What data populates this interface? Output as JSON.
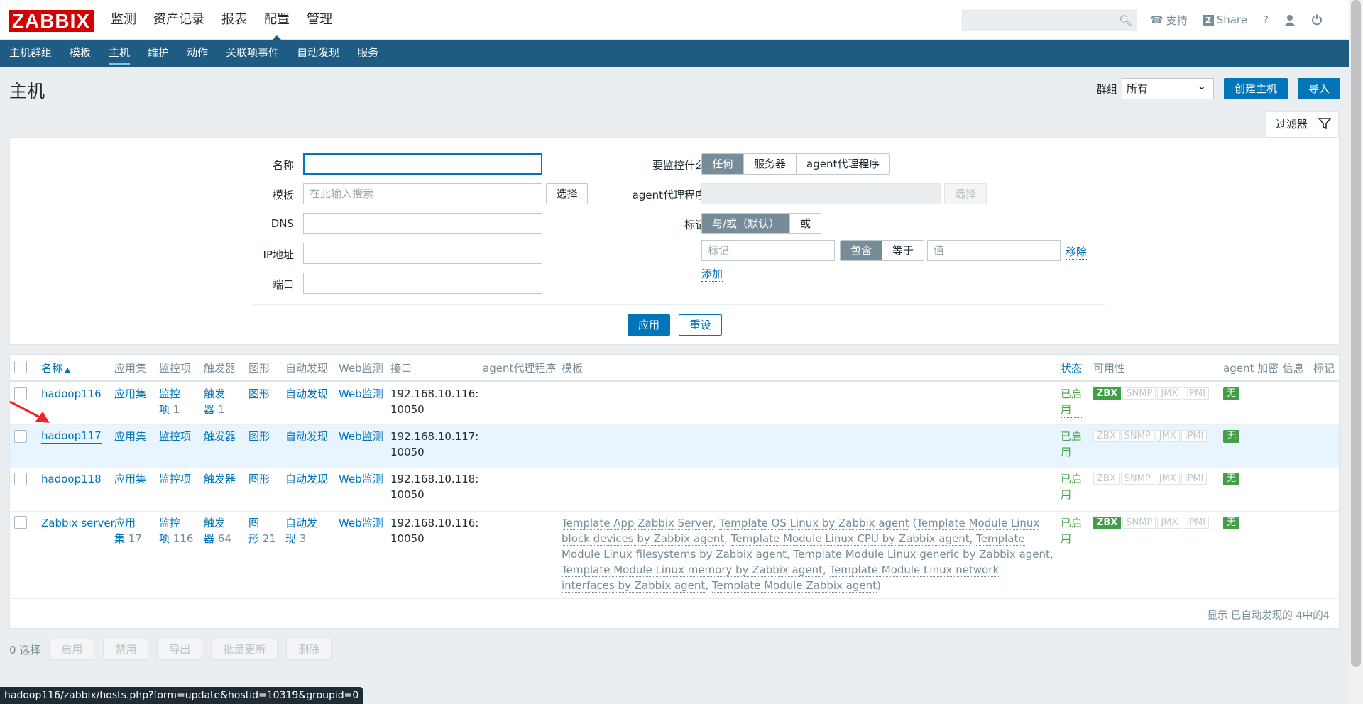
{
  "logo": "ZABBIX",
  "topmenu": [
    "监测",
    "资产记录",
    "报表",
    "配置",
    "管理"
  ],
  "toplinks": {
    "support": "支持",
    "share": "Share",
    "help": "?"
  },
  "submenu": [
    "主机群组",
    "模板",
    "主机",
    "维护",
    "动作",
    "关联项事件",
    "自动发现",
    "服务"
  ],
  "page": {
    "title": "主机",
    "group_label": "群组",
    "group_value": "所有",
    "create_btn": "创建主机",
    "import_btn": "导入"
  },
  "filter": {
    "tab": "过滤器",
    "name_label": "名称",
    "template_label": "模板",
    "template_placeholder": "在此输入搜索",
    "select_btn": "选择",
    "dns_label": "DNS",
    "ip_label": "IP地址",
    "port_label": "端口",
    "monitored_by_label": "要监控什么",
    "monitored_by": [
      "任何",
      "服务器",
      "agent代理程序"
    ],
    "proxy_label": "agent代理程序",
    "proxy_select_btn": "选择",
    "tags_label": "标记",
    "tags_mode": [
      "与/或（默认）",
      "或"
    ],
    "tag_placeholder": "标记",
    "tag_ops": [
      "包含",
      "等于"
    ],
    "value_placeholder": "值",
    "remove": "移除",
    "add": "添加",
    "apply": "应用",
    "reset": "重设"
  },
  "table": {
    "headers": {
      "name": "名称",
      "apps": "应用集",
      "items": "监控项",
      "triggers": "触发器",
      "graphs": "图形",
      "discovery": "自动发现",
      "web": "Web监测",
      "interface": "接口",
      "proxy": "agent代理程序",
      "templates": "模板",
      "status": "状态",
      "availability": "可用性",
      "encryption": "agent 加密",
      "info": "信息",
      "tags": "标记"
    },
    "rows": [
      {
        "name": "hadoop116",
        "apps": "应用集",
        "apps_count": "",
        "items_a": "监控",
        "items_b": "项",
        "items_count": "1",
        "triggers_a": "触发",
        "triggers_b": "器",
        "triggers_count": "1",
        "graphs": "图形",
        "discovery": "自动发现",
        "web": "Web监测",
        "interface_a": "192.168.10.116:",
        "interface_b": "10050",
        "status_a": "已启",
        "status_b": "用",
        "avail": [
          "ZBX",
          "SNMP",
          "JMX",
          "IPMI"
        ],
        "avail_on": [
          true,
          false,
          false,
          false
        ],
        "enc": "无"
      },
      {
        "name": "hadoop117",
        "apps": "应用集",
        "items": "监控项",
        "triggers": "触发器",
        "graphs": "图形",
        "discovery": "自动发现",
        "web": "Web监测",
        "interface_a": "192.168.10.117:",
        "interface_b": "10050",
        "status_a": "已启",
        "status_b": "用",
        "avail": [
          "ZBX",
          "SNMP",
          "JMX",
          "IPMI"
        ],
        "avail_on": [
          false,
          false,
          false,
          false
        ],
        "enc": "无"
      },
      {
        "name": "hadoop118",
        "apps": "应用集",
        "items": "监控项",
        "triggers": "触发器",
        "graphs": "图形",
        "discovery": "自动发现",
        "web": "Web监测",
        "interface_a": "192.168.10.118:",
        "interface_b": "10050",
        "status_a": "已启",
        "status_b": "用",
        "avail": [
          "ZBX",
          "SNMP",
          "JMX",
          "IPMI"
        ],
        "avail_on": [
          false,
          false,
          false,
          false
        ],
        "enc": "无"
      },
      {
        "name": "Zabbix server",
        "apps_a": "应用",
        "apps_b": "集",
        "apps_count": "17",
        "items_a": "监控",
        "items_b": "项",
        "items_count": "116",
        "triggers_a": "触发",
        "triggers_b": "器",
        "triggers_count": "64",
        "graphs_a": "图",
        "graphs_b": "形",
        "graphs_count": "21",
        "discovery_a": "自动发",
        "discovery_b": "现",
        "discovery_count": "3",
        "web": "Web监测",
        "interface_a": "192.168.10.116:",
        "interface_b": "10050",
        "templates": [
          "Template App Zabbix Server",
          "Template OS Linux by Zabbix agent",
          "Template Module Linux block devices by Zabbix agent",
          "Template Module Linux CPU by Zabbix agent",
          "Template Module Linux filesystems by Zabbix agent",
          "Template Module Linux generic by Zabbix agent",
          "Template Module Linux memory by Zabbix agent",
          "Template Module Linux network interfaces by Zabbix agent",
          "Template Module Zabbix agent"
        ],
        "status_a": "已启",
        "status_b": "用",
        "avail": [
          "ZBX",
          "SNMP",
          "JMX",
          "IPMI"
        ],
        "avail_on": [
          true,
          false,
          false,
          false
        ],
        "enc": "无"
      }
    ],
    "footer": "显示 已自动发现的 4中的4"
  },
  "actions": {
    "selected": "0 选择",
    "buttons": [
      "启用",
      "禁用",
      "导出",
      "批量更新",
      "删除"
    ]
  },
  "status_url": "hadoop116/zabbix/hosts.php?form=update&hostid=10319&groupid=0",
  "colors": {
    "nav": "#1f5c84",
    "link": "#0275b8",
    "green": "#429e47",
    "logo": "#d40000"
  }
}
